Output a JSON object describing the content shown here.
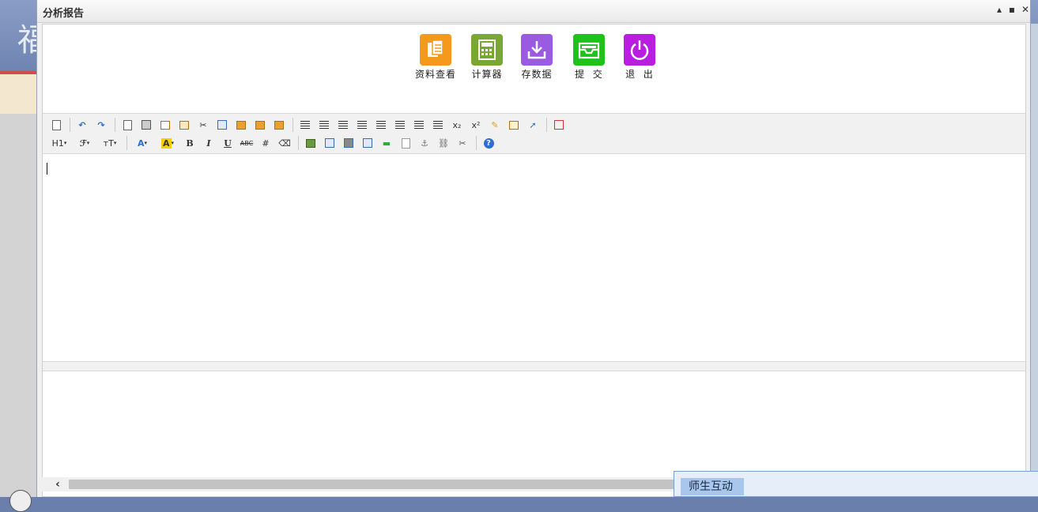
{
  "window": {
    "title": "分析报告",
    "controls": {
      "minimize": "▴",
      "maximize": "▪",
      "close": "✕"
    }
  },
  "actions": [
    {
      "label": "资料查看",
      "icon": "document-icon",
      "color": "#f39a1c"
    },
    {
      "label": "计算器",
      "icon": "calculator-icon",
      "color": "#7aa634"
    },
    {
      "label": "存数据",
      "icon": "download-icon",
      "color": "#9a5ae2"
    },
    {
      "label": "提  交",
      "icon": "inbox-icon",
      "color": "#1fc21a"
    },
    {
      "label": "退  出",
      "icon": "power-icon",
      "color": "#b81de0"
    }
  ],
  "toolbar": {
    "heading_label": "H1",
    "font_label": "ℱ",
    "size_label": "тT",
    "font_color_label": "A",
    "highlight_label": "A",
    "bold_label": "B",
    "italic_label": "I",
    "underline_label": "U",
    "strike_label": "ABC",
    "subscript_label": "x₂",
    "superscript_label": "x²"
  },
  "editor": {
    "content": ""
  },
  "chat": {
    "tab_label": "师生互动"
  }
}
